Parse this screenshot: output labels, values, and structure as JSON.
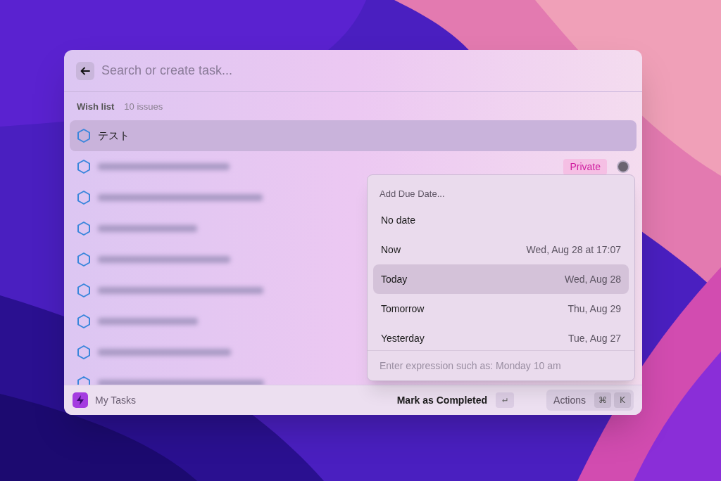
{
  "search": {
    "placeholder": "Search or create task..."
  },
  "list": {
    "title": "Wish list",
    "count": "10 issues"
  },
  "rows": [
    {
      "kind": "task",
      "title": "テスト",
      "selected": true
    },
    {
      "kind": "blurred",
      "selected": false,
      "badge": "Private"
    },
    {
      "kind": "blurred",
      "selected": false
    },
    {
      "kind": "blurred",
      "selected": false
    },
    {
      "kind": "blurred",
      "selected": false
    },
    {
      "kind": "blurred",
      "selected": false
    },
    {
      "kind": "blurred",
      "selected": false
    },
    {
      "kind": "blurred",
      "selected": false
    },
    {
      "kind": "blurred",
      "selected": false
    }
  ],
  "popup": {
    "title": "Add Due Date...",
    "options": [
      {
        "label": "No date",
        "selected": false
      },
      {
        "label": "Now",
        "date": "Wed, Aug 28 at 17:07",
        "selected": false
      },
      {
        "label": "Today",
        "date": "Wed, Aug 28",
        "selected": true
      },
      {
        "label": "Tomorrow",
        "date": "Thu, Aug 29",
        "selected": false
      },
      {
        "label": "Yesterday",
        "date": "Tue, Aug 27",
        "selected": false
      }
    ],
    "input": {
      "placeholder": "Enter expression such as: Monday 10 am"
    }
  },
  "footer": {
    "app": "My Tasks",
    "primary_action": "Mark as Completed",
    "enter_key": "↵",
    "actions": "Actions",
    "keys": [
      "⌘",
      "K"
    ]
  }
}
